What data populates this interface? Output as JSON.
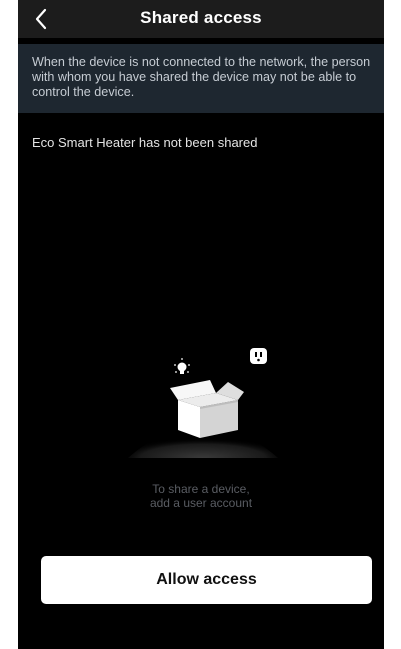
{
  "header": {
    "title": "Shared access",
    "back_icon": "chevron-left-icon"
  },
  "notice": {
    "text": "When the device is not connected to the network, the person with whom you have shared the device may not be able to control the device."
  },
  "status": {
    "text": "Eco Smart Heater has not been shared"
  },
  "empty_state": {
    "illustration_icons": [
      "open-box-icon",
      "light-bulb-icon",
      "power-outlet-icon"
    ],
    "hint_line1": "To share a device,",
    "hint_line2": "add a user account"
  },
  "actions": {
    "allow_label": "Allow access"
  },
  "colors": {
    "background": "#000000",
    "header": "#1c1c1c",
    "notice_bg": "#1e2730",
    "button_bg": "#ffffff"
  }
}
